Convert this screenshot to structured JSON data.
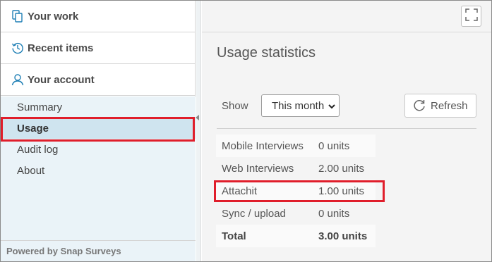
{
  "sidebar": {
    "sections": [
      {
        "label": "Your work",
        "icon": "documents-icon"
      },
      {
        "label": "Recent items",
        "icon": "history-icon"
      },
      {
        "label": "Your account",
        "icon": "user-icon"
      }
    ],
    "submenu": [
      {
        "label": "Summary"
      },
      {
        "label": "Usage",
        "active": true
      },
      {
        "label": "Audit log"
      },
      {
        "label": "About"
      }
    ],
    "footer": "Powered by Snap Surveys"
  },
  "main": {
    "title": "Usage statistics",
    "show_label": "Show",
    "period_select": {
      "value": "This month"
    },
    "refresh_label": "Refresh",
    "stats": [
      {
        "label": "Mobile Interviews",
        "value": "0 units"
      },
      {
        "label": "Web Interviews",
        "value": "2.00 units"
      },
      {
        "label": "Attachit",
        "value": "1.00 units"
      },
      {
        "label": "Sync / upload",
        "value": "0 units"
      },
      {
        "label": "Total",
        "value": "3.00 units"
      }
    ]
  },
  "colors": {
    "accent_icon": "#1f7fb5",
    "highlight_box": "#e01e2b",
    "submenu_bg": "#eaf3f8",
    "active_item_bg": "#cfe4ef"
  }
}
